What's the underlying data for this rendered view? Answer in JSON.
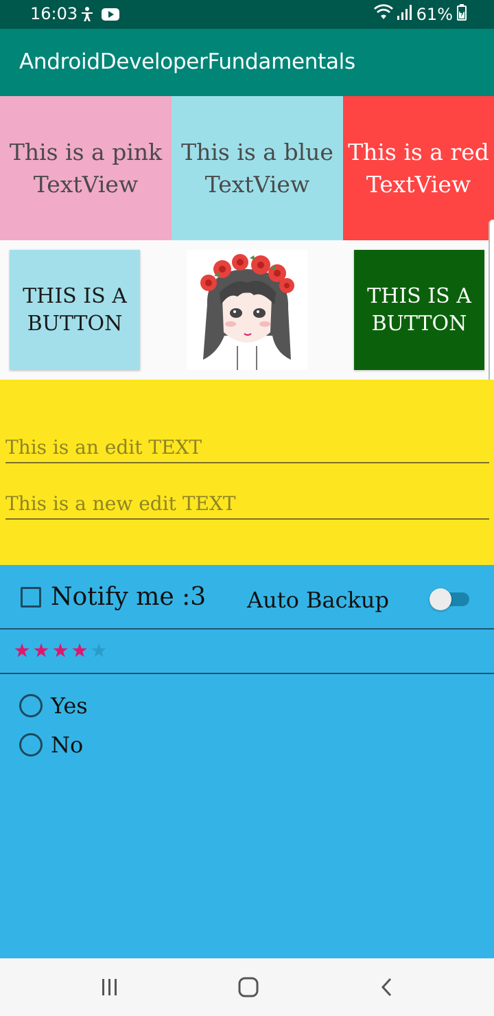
{
  "status_bar": {
    "time": "16:03",
    "battery": "61%",
    "icons_left": [
      "accessibility-icon",
      "youtube-icon"
    ],
    "icons_right": [
      "wifi-icon",
      "signal-icon",
      "battery-icon"
    ]
  },
  "app_bar": {
    "title": "AndroidDeveloperFundamentals",
    "color": "#008577"
  },
  "text_views": {
    "pink": {
      "text": "This is a pink TextView",
      "color": "#f1aac8"
    },
    "blue": {
      "text": "This is a blue TextView",
      "color": "#9ddfe9"
    },
    "red": {
      "text": "This is a red TextView",
      "color": "#ff4444"
    }
  },
  "buttons": {
    "blue": {
      "label": "THIS IS A BUTTON",
      "color": "#a2dfeb"
    },
    "green": {
      "label": "THIS IS A BUTTON",
      "color": "#0b610b"
    }
  },
  "image": {
    "icon": "anime-girl-flower-crown-illustration"
  },
  "edit_texts": {
    "first": {
      "placeholder": "This is an edit TEXT",
      "value": ""
    },
    "second": {
      "placeholder": "This is a new edit TEXT",
      "value": ""
    },
    "background": "#fde61f"
  },
  "controls": {
    "checkbox": {
      "label": "Notify me :3",
      "checked": false
    },
    "switch": {
      "label": "Auto Backup",
      "on": false
    },
    "rating": {
      "value": 4,
      "max": 5
    },
    "radio_options": [
      {
        "label": "Yes",
        "selected": false
      },
      {
        "label": "No",
        "selected": false
      }
    ],
    "background": "#34b4e6"
  },
  "nav_bar": {
    "buttons": [
      "recent-apps-icon",
      "home-icon",
      "back-icon"
    ]
  }
}
